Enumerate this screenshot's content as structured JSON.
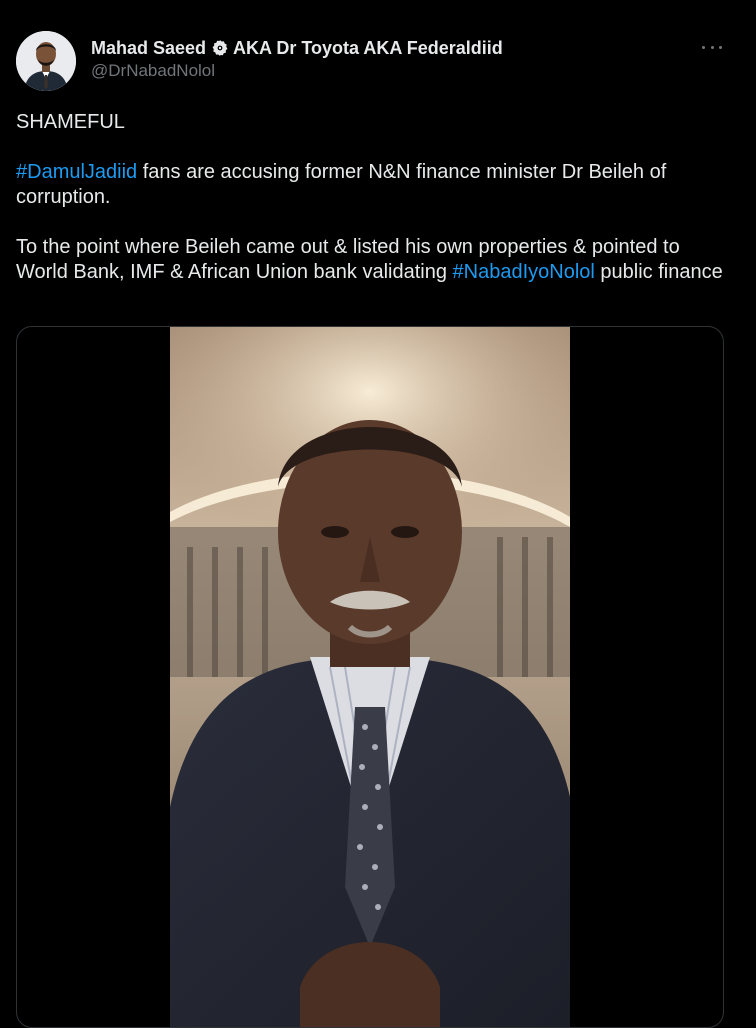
{
  "author": {
    "display_name": "Mahad Saeed",
    "verified_icon": "verified-badge-icon",
    "alias": "AKA Dr Toyota AKA Federaldiid",
    "handle": "@DrNabadNolol",
    "avatar": "profile-photo"
  },
  "menu": {
    "icon": "more-dots-icon"
  },
  "post": {
    "line1": "SHAMEFUL",
    "p2_hashtag": "#DamulJadiid",
    "p2_text": " fans are accusing former N&N finance minister Dr Beileh of corruption.",
    "p3_text": "To the point where Beileh came out & listed his own properties & pointed to World Bank, IMF & African Union bank validating ",
    "p3_hashtag": "#NabadIyoNolol",
    "p3_tail": " public finance"
  },
  "media": {
    "type": "video",
    "subject": "man in suit and tie seated in hotel room"
  },
  "colors": {
    "background": "#000000",
    "text": "#e7e9ea",
    "secondary": "#71767b",
    "link": "#1d9bf0",
    "border": "#2f3336"
  }
}
